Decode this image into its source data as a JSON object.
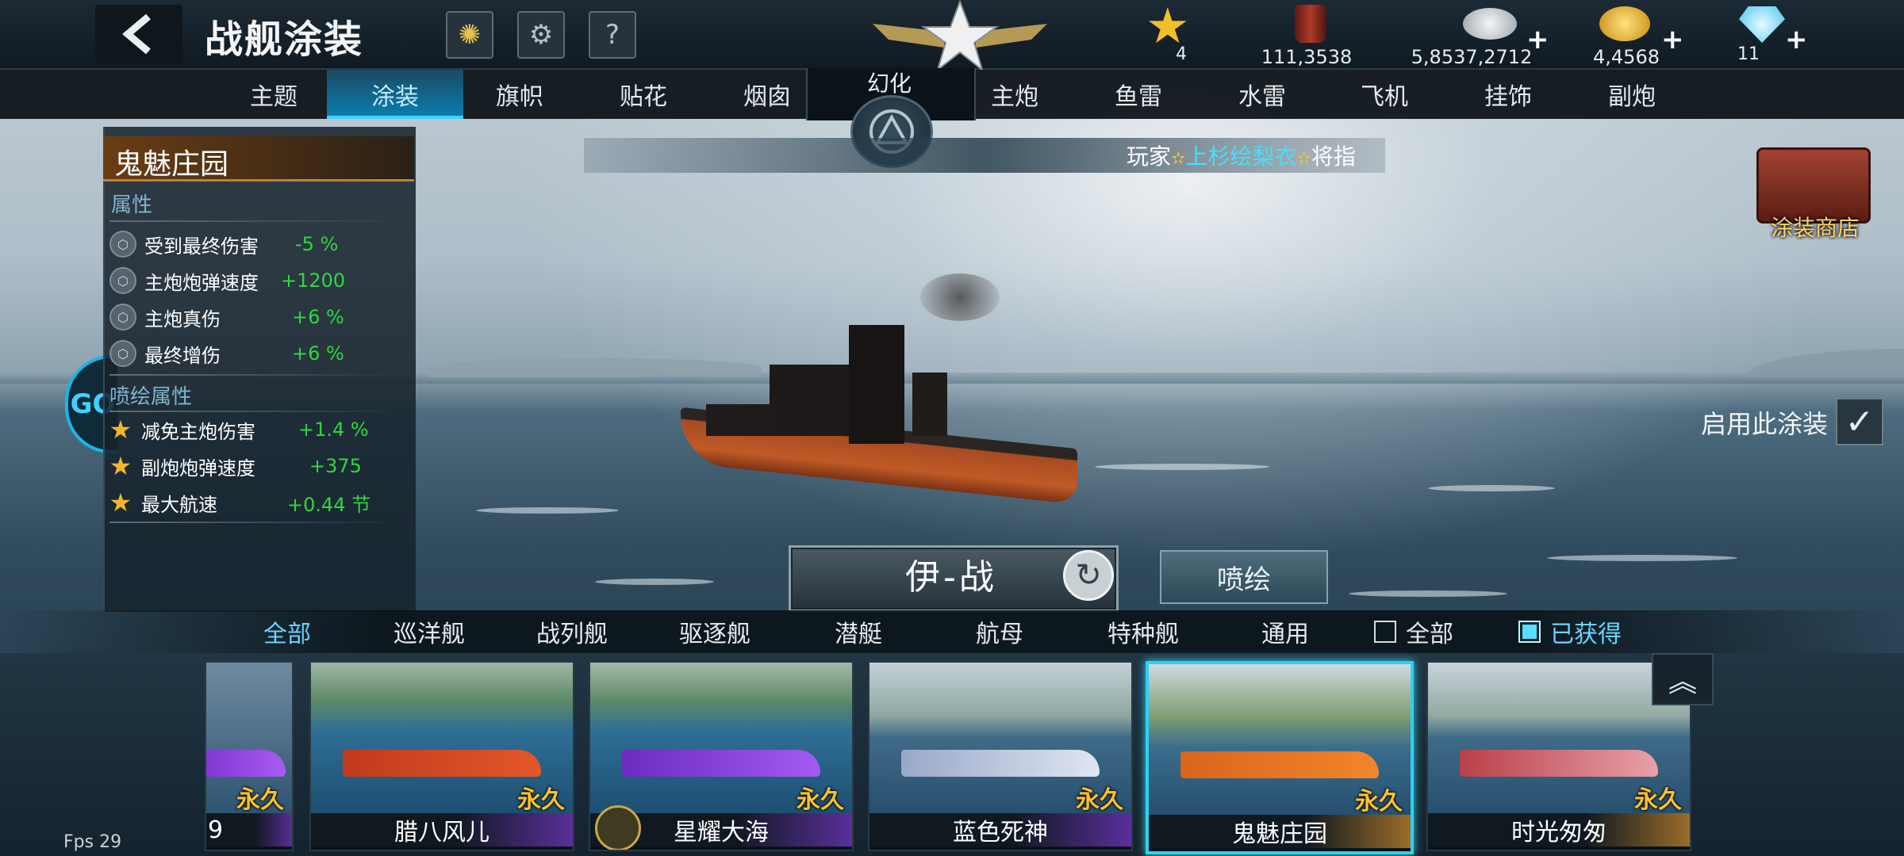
{
  "header": {
    "title": "战舰涂装",
    "resources": [
      {
        "name": "star-rank",
        "value": "4",
        "icon": "star-icon"
      },
      {
        "name": "paint-bucket",
        "value": "111,3538",
        "icon": "paint-bucket-icon"
      },
      {
        "name": "silver",
        "value": "5,8537,2712",
        "icon": "silver-coins-icon"
      },
      {
        "name": "gold",
        "value": "4,4568",
        "icon": "gold-coins-icon"
      },
      {
        "name": "diamond",
        "value": "11",
        "icon": "diamond-icon"
      }
    ],
    "plus": "+"
  },
  "tabs": [
    "主题",
    "涂装",
    "旗帜",
    "贴花",
    "烟囱",
    "主炮",
    "鱼雷",
    "水雷",
    "飞机",
    "挂饰",
    "副炮"
  ],
  "fuse_tab": "幻化",
  "marquee": {
    "prefix": "玩家",
    "player": "上杉绘梨衣",
    "suffix": "将指"
  },
  "skin": {
    "name": "鬼魅庄园",
    "attr_title": "属性",
    "attrs": [
      {
        "label": "受到最终伤害",
        "value": "-5 %"
      },
      {
        "label": "主炮炮弹速度",
        "value": "+1200"
      },
      {
        "label": "主炮真伤",
        "value": "+6 %"
      },
      {
        "label": "最终增伤",
        "value": "+6 %"
      }
    ],
    "spray_title": "喷绘属性",
    "spray_attrs": [
      {
        "label": "减免主炮伤害",
        "value": "+1.4 %"
      },
      {
        "label": "副炮炮弹速度",
        "value": "+375"
      },
      {
        "label": "最大航速",
        "value": "+0.44 节"
      }
    ]
  },
  "side_badge": "GO",
  "ship_name": "伊-战",
  "spray_button": "喷绘",
  "apply_label": "启用此涂装",
  "shop_label": "涂装商店",
  "filters": [
    "全部",
    "巡洋舰",
    "战列舰",
    "驱逐舰",
    "潜艇",
    "航母",
    "特种舰",
    "通用"
  ],
  "checkbox_all": "全部",
  "checkbox_owned": "已获得",
  "cards": [
    {
      "name": "",
      "tag": "永久",
      "partial_name": "9"
    },
    {
      "name": "腊八风儿",
      "tag": "永久"
    },
    {
      "name": "星耀大海",
      "tag": "永久"
    },
    {
      "name": "蓝色死神",
      "tag": "永久"
    },
    {
      "name": "鬼魅庄园",
      "tag": "永久"
    },
    {
      "name": "时光匆匆",
      "tag": "永久"
    }
  ],
  "fps": "Fps 29",
  "colors": {
    "accent": "#2fd0f0",
    "attr_value": "#2fd83d",
    "gold": "#ffc12a"
  }
}
